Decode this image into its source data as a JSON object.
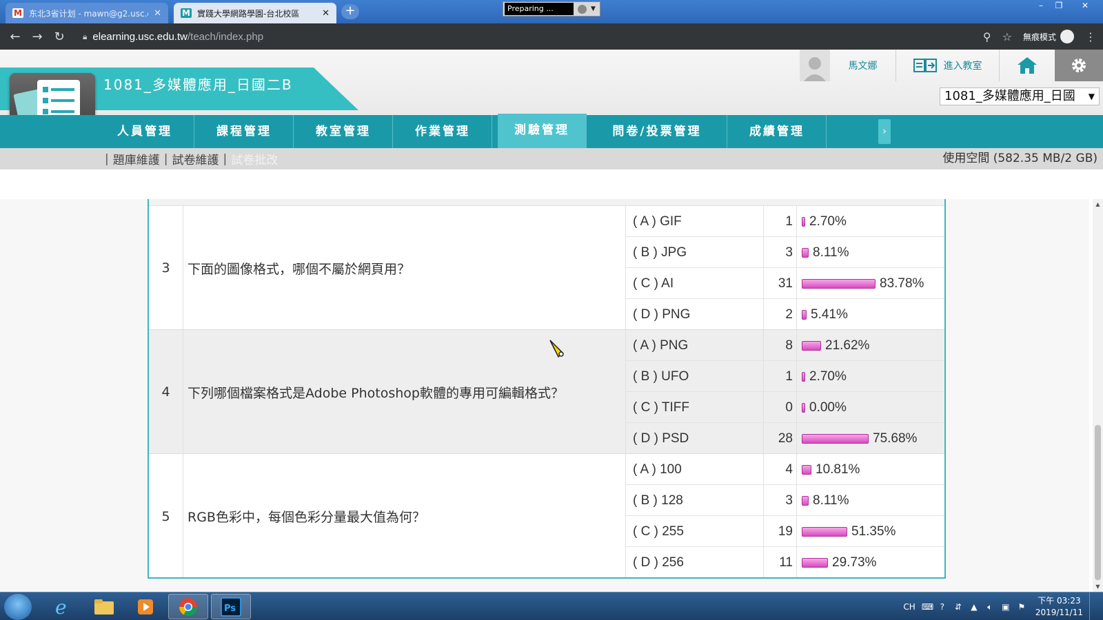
{
  "browser": {
    "tabs": [
      {
        "title": "东北3省计划 - mawn@g2.usc.e",
        "favicon": "gmail-icon",
        "active": false
      },
      {
        "title": "實踐大學網路學園-台北校區",
        "favicon": "m-icon",
        "active": true
      }
    ],
    "recorder_label": "Preparing ...",
    "url_host": "elearning.usc.edu.tw",
    "url_path": "/teach/index.php",
    "incognito_label": "無痕模式"
  },
  "site": {
    "course_title": "1081_多媒體應用_日國二B",
    "user_name": "馬文娜",
    "enter_classroom": "進入教室",
    "course_select": "1081_多媒體應用_日國",
    "main_nav": [
      {
        "label": "人員管理",
        "active": false
      },
      {
        "label": "課程管理",
        "active": false
      },
      {
        "label": "教室管理",
        "active": false
      },
      {
        "label": "作業管理",
        "active": false
      },
      {
        "label": "測驗管理",
        "active": true
      },
      {
        "label": "問卷/投票管理",
        "active": false
      },
      {
        "label": "成績管理",
        "active": false
      }
    ],
    "sub_nav": [
      {
        "label": "題庫維護",
        "current": false
      },
      {
        "label": "試卷維護",
        "current": false
      },
      {
        "label": "試卷批改",
        "current": true
      }
    ],
    "usage": "使用空間 (582.35 MB/2 GB)"
  },
  "questions": [
    {
      "number": "3",
      "text": "下面的圖像格式，哪個不屬於網頁用？",
      "options": [
        {
          "label": "( A ) GIF",
          "count": "1",
          "percent": "2.70%",
          "fraction": 0.027
        },
        {
          "label": "( B ) JPG",
          "count": "3",
          "percent": "8.11%",
          "fraction": 0.0811
        },
        {
          "label": "( C ) AI",
          "count": "31",
          "percent": "83.78%",
          "fraction": 0.8378
        },
        {
          "label": "( D ) PNG",
          "count": "2",
          "percent": "5.41%",
          "fraction": 0.0541
        }
      ]
    },
    {
      "number": "4",
      "text": "下列哪個檔案格式是Adobe Photoshop軟體的專用可編輯格式？",
      "options": [
        {
          "label": "( A ) PNG",
          "count": "8",
          "percent": "21.62%",
          "fraction": 0.2162
        },
        {
          "label": "( B ) UFO",
          "count": "1",
          "percent": "2.70%",
          "fraction": 0.027
        },
        {
          "label": "( C ) TIFF",
          "count": "0",
          "percent": "0.00%",
          "fraction": 0.0
        },
        {
          "label": "( D ) PSD",
          "count": "28",
          "percent": "75.68%",
          "fraction": 0.7568
        }
      ]
    },
    {
      "number": "5",
      "text": "RGB色彩中，每個色彩分量最大值為何？",
      "options": [
        {
          "label": "( A ) 100",
          "count": "4",
          "percent": "10.81%",
          "fraction": 0.1081
        },
        {
          "label": "( B ) 128",
          "count": "3",
          "percent": "8.11%",
          "fraction": 0.0811
        },
        {
          "label": "( C ) 255",
          "count": "19",
          "percent": "51.35%",
          "fraction": 0.5135
        },
        {
          "label": "( D ) 256",
          "count": "11",
          "percent": "29.73%",
          "fraction": 0.2973
        }
      ]
    }
  ],
  "taskbar": {
    "apps": [
      "ie-icon",
      "explorer-icon",
      "media-player-icon",
      "chrome-icon",
      "photoshop-icon"
    ],
    "ime": "CH",
    "time": "下午 03:23",
    "date": "2019/11/11"
  },
  "colors": {
    "teal_nav": "#1a9aa8",
    "teal_active": "#4fc4cf",
    "bar_pink": "#e066cc",
    "table_border": "#3db5bf"
  }
}
